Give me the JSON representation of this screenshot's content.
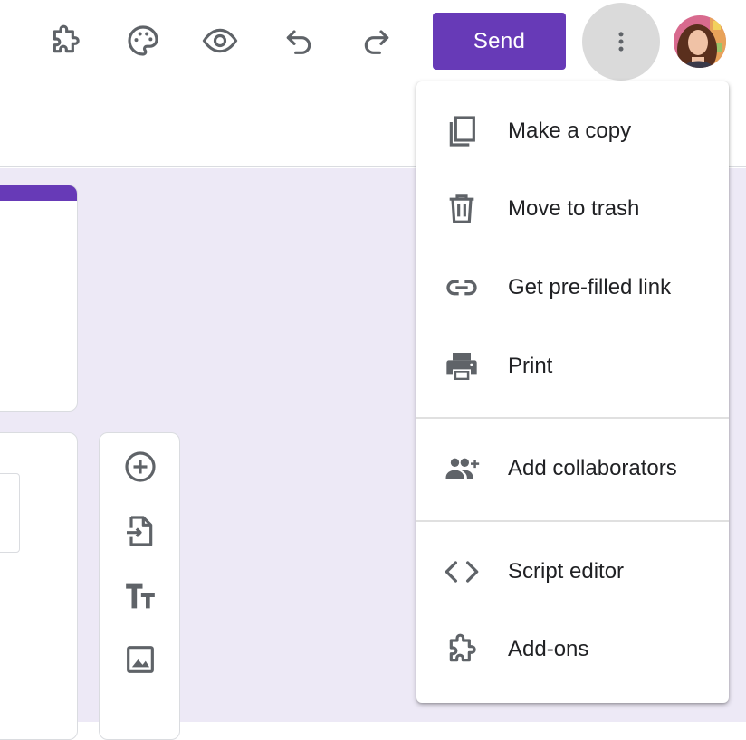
{
  "toolbar": {
    "icons": [
      "puzzle-icon",
      "palette-icon",
      "eye-icon",
      "undo-icon",
      "redo-icon"
    ],
    "send_label": "Send",
    "more_icon": "more-vert-icon",
    "accent_color": "#673ab7"
  },
  "side_toolbar": {
    "icons": [
      "add-circle-icon",
      "import-questions-icon",
      "title-text-icon",
      "image-icon"
    ]
  },
  "menu": {
    "items": [
      {
        "label": "Make a copy",
        "icon": "copy-icon"
      },
      {
        "label": "Move to trash",
        "icon": "trash-icon"
      },
      {
        "label": "Get pre-filled link",
        "icon": "link-icon"
      },
      {
        "label": "Print",
        "icon": "print-icon"
      },
      {
        "label": "Add collaborators",
        "icon": "add-people-icon"
      },
      {
        "label": "Script editor",
        "icon": "code-icon"
      },
      {
        "label": "Add-ons",
        "icon": "puzzle-icon"
      }
    ]
  },
  "colors": {
    "background": "#ede9f6",
    "icon": "#5f6368",
    "more_button_active": "#dadada"
  }
}
